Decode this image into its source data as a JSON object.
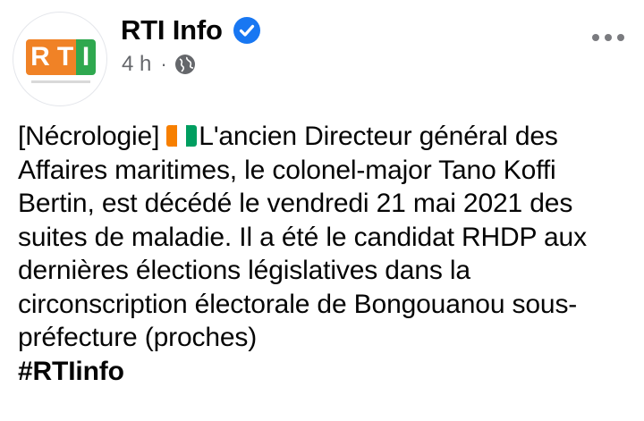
{
  "post": {
    "page_name": "RTI Info",
    "avatar_text": {
      "r": "R",
      "t": "T",
      "i": "I"
    },
    "time": "4 h",
    "dot": "·",
    "verified_icon": "verified-badge-icon",
    "audience_icon": "globe-icon",
    "more_icon": "more-options-icon",
    "text_tag": "[Nécrologie]",
    "text_main": "L'ancien Directeur général des Affaires maritimes, le colonel-major Tano Koffi Bertin, est décédé le vendredi 21 mai 2021 des suites de maladie. Il a été le candidat RHDP aux dernières élections législatives dans la circonscription électorale de Bongouanou sous-préfecture (proches)",
    "hashtag": "#RTIinfo"
  },
  "colors": {
    "verified_blue": "#1877f2",
    "logo_orange": "#f08226",
    "logo_green": "#2fa84f",
    "meta_grey": "#65676b",
    "flag_orange": "#f77f00",
    "flag_white": "#ffffff",
    "flag_green": "#009e60"
  }
}
